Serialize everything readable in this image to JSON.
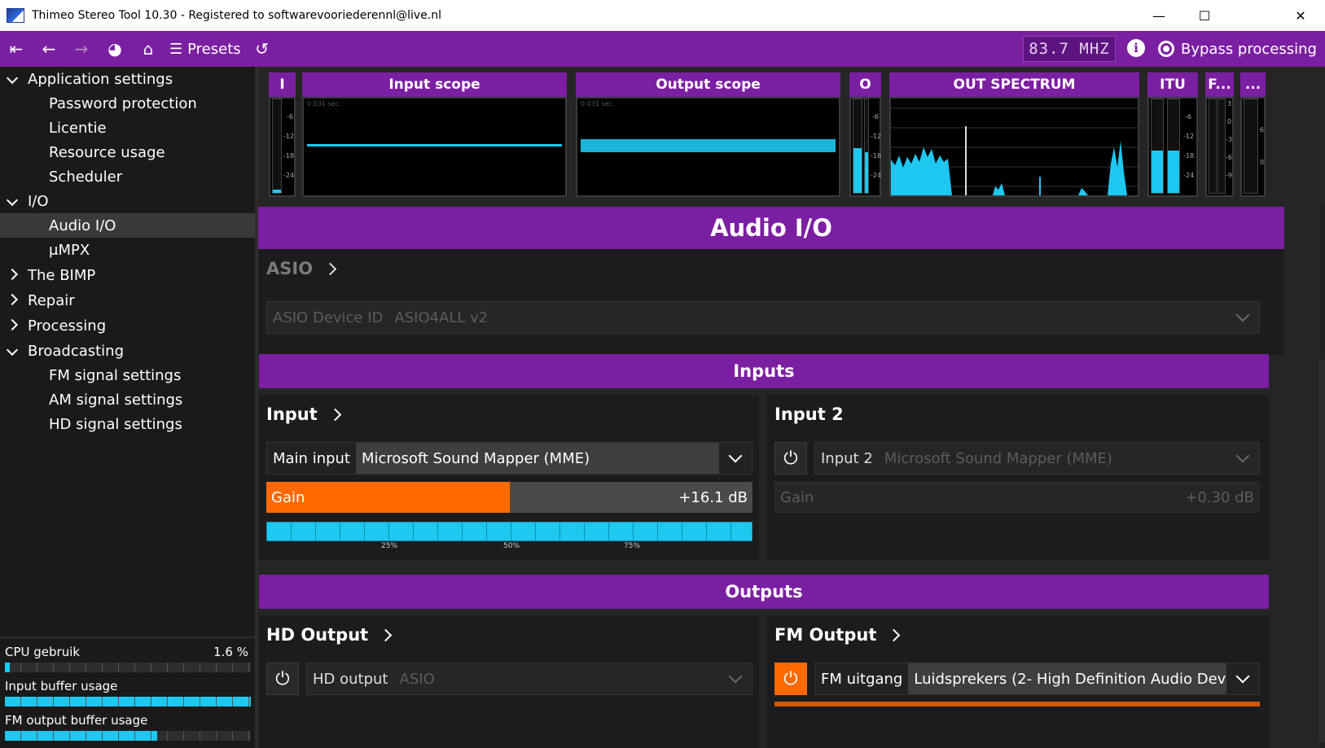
{
  "window": {
    "title": "Thimeo Stereo Tool 10.30 - Registered to softwarevooriederennl@live.nl",
    "controls": {
      "minimize": "—",
      "maximize": "☐",
      "close": "✕"
    }
  },
  "toolbar": {
    "first_icon": "skip-back-icon",
    "back_icon": "arrow-left-icon",
    "forward_icon": "arrow-right-icon",
    "dashboard_icon": "gauge-icon",
    "home_icon": "home-icon",
    "presets_label": "Presets",
    "undo_icon": "undo-icon",
    "frequency": "83.7 MHZ",
    "info_icon": "info-icon",
    "bypass_label": "Bypass processing"
  },
  "sidebar": {
    "items": [
      {
        "label": "Application settings",
        "level": 0,
        "expanded": true
      },
      {
        "label": "Password protection",
        "level": 1
      },
      {
        "label": "Licentie",
        "level": 1
      },
      {
        "label": "Resource usage",
        "level": 1
      },
      {
        "label": "Scheduler",
        "level": 1
      },
      {
        "label": "I/O",
        "level": 0,
        "expanded": true
      },
      {
        "label": "Audio I/O",
        "level": 1,
        "selected": true
      },
      {
        "label": "μMPX",
        "level": 1
      },
      {
        "label": "The BIMP",
        "level": 0,
        "expanded": false
      },
      {
        "label": "Repair",
        "level": 0,
        "expanded": false
      },
      {
        "label": "Processing",
        "level": 0,
        "expanded": false
      },
      {
        "label": "Broadcasting",
        "level": 0,
        "expanded": true
      },
      {
        "label": "FM signal settings",
        "level": 1
      },
      {
        "label": "AM signal settings",
        "level": 1
      },
      {
        "label": "HD signal settings",
        "level": 1
      }
    ],
    "status": {
      "cpu_label": "CPU gebruik",
      "cpu_value": "1.6 %",
      "cpu_level": 0.016,
      "input_buffer_label": "Input buffer usage",
      "input_buffer_level": 1.0,
      "fm_buffer_label": "FM output buffer usage",
      "fm_buffer_level": 0.62
    }
  },
  "meters": {
    "input_label": "I",
    "input_scope_label": "Input scope",
    "output_scope_label": "Output scope",
    "output_label": "O",
    "spectrum_label": "OUT SPECTRUM",
    "itu_label": "ITU",
    "f_label": "F...",
    "more_label": "...",
    "scope_time": "0.031 sec.",
    "db_ticks": [
      "-6",
      "-12",
      "-18",
      "-24"
    ],
    "f_ticks": [
      "3",
      "0",
      "-3",
      "-6",
      "-9"
    ],
    "more_ticks": [
      "6",
      "0"
    ]
  },
  "page": {
    "title": "Audio I/O",
    "asio": {
      "title": "ASIO",
      "device_label": "ASIO Device ID",
      "device_value": "ASIO4ALL v2"
    },
    "inputs": {
      "header": "Inputs",
      "input1": {
        "title": "Input",
        "source_label": "Main input",
        "source_value": "Microsoft Sound Mapper (MME)",
        "gain_label": "Gain",
        "gain_value": "+16.1 dB",
        "gain_level": 0.5,
        "scale": [
          "25%",
          "50%",
          "75%"
        ]
      },
      "input2": {
        "title": "Input 2",
        "source_label": "Input 2",
        "source_value": "Microsoft Sound Mapper (MME)",
        "gain_label": "Gain",
        "gain_value": "+0.30 dB"
      }
    },
    "outputs": {
      "header": "Outputs",
      "hd": {
        "title": "HD Output",
        "label": "HD output",
        "value": "ASIO"
      },
      "fm": {
        "title": "FM Output",
        "label": "FM uitgang",
        "value": "Luidsprekers (2- High Definition Audio Dev..."
      }
    }
  },
  "colors": {
    "accent": "#7b1fa2",
    "meter": "#1ec8f0",
    "gain": "#ff6a00"
  }
}
